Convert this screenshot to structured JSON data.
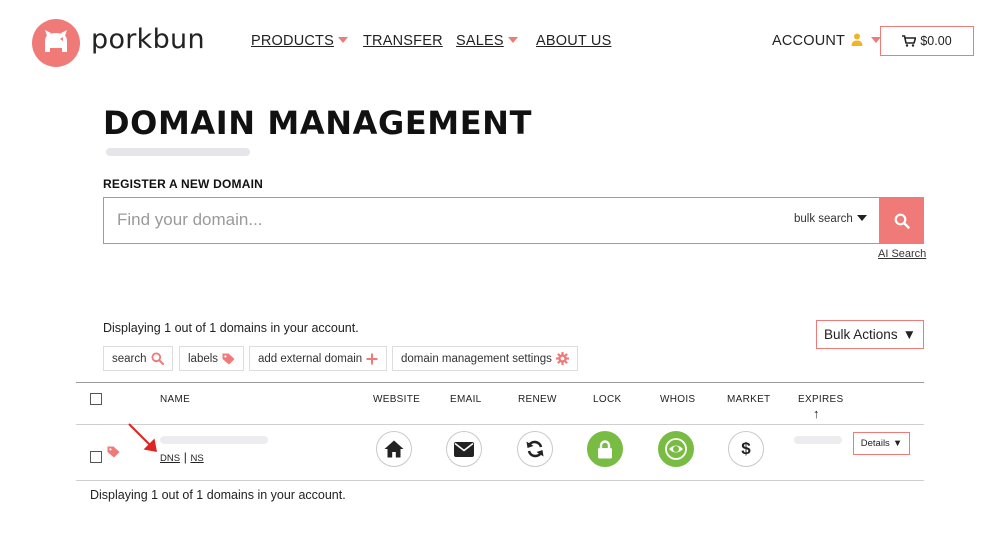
{
  "brand": {
    "name": "porkbun"
  },
  "nav": {
    "products": "PRODUCTS",
    "transfer": "TRANSFER",
    "sales": "SALES",
    "about": "ABOUT US",
    "account": "ACCOUNT",
    "cart_total": "$0.00"
  },
  "page": {
    "title": "DOMAIN MANAGEMENT",
    "register_label": "REGISTER A NEW DOMAIN"
  },
  "search": {
    "placeholder": "Find your domain...",
    "value": "",
    "bulk_search_label": "bulk search",
    "ai_search_label": "AI Search"
  },
  "domains": {
    "displaying_text": "Displaying 1 out of 1 domains in your account.",
    "bulk_actions_label": "Bulk Actions",
    "bulk_actions_caret": "▼",
    "filters": [
      {
        "label": "search",
        "icon": "search-icon"
      },
      {
        "label": "labels",
        "icon": "tag-icon"
      },
      {
        "label": "add external domain",
        "icon": "plus-icon"
      },
      {
        "label": "domain management settings",
        "icon": "gear-icon"
      }
    ],
    "columns": {
      "name": "NAME",
      "website": "WEBSITE",
      "email": "EMAIL",
      "renew": "RENEW",
      "lock": "LOCK",
      "whois": "WHOIS",
      "market": "MARKET",
      "expires": "EXPIRES",
      "sort_indicator": "↑"
    },
    "row": {
      "dns_label": "DNS",
      "separator": "|",
      "ns_label": "NS",
      "details_label": "Details",
      "details_caret": "▼"
    }
  },
  "colors": {
    "accent": "#ef7a78",
    "success": "#79bc44",
    "account_icon": "#f0b429",
    "annotation_arrow": "#e02424"
  }
}
